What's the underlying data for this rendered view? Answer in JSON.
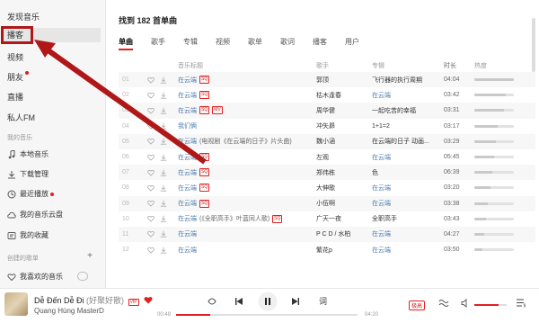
{
  "sidebar": {
    "discover": "发现音乐",
    "podcast": "播客",
    "video": "视频",
    "friends": "朋友",
    "live": "直播",
    "private_fm": "私人FM",
    "my_music_label": "我的音乐",
    "local_music": "本地音乐",
    "downloads": "下载管理",
    "recent": "最近播放",
    "cloud": "我的音乐云盘",
    "collection": "我的收藏",
    "created_label": "创建的歌单",
    "created_plus": "+",
    "liked": "我喜欢的音乐"
  },
  "main": {
    "title": "找到 182 首单曲",
    "tabs": [
      "单曲",
      "歌手",
      "专辑",
      "视频",
      "歌单",
      "歌词",
      "播客",
      "用户"
    ],
    "columns": {
      "title": "音乐标题",
      "artist": "歌手",
      "album": "专辑",
      "duration": "时长",
      "hot": "热度"
    },
    "rows": [
      {
        "num": "01",
        "title": "在云端",
        "tags": [
          "SQ"
        ],
        "rest": "",
        "artist": "郭顶",
        "album": "飞行器的执行周期",
        "album_blue": false,
        "duration": "04:04",
        "hot": 1.0
      },
      {
        "num": "02",
        "title": "在云端",
        "tags": [
          "SQ"
        ],
        "rest": "",
        "artist": "枯木逢春",
        "album": "在云端",
        "album_blue": true,
        "duration": "03:42",
        "hot": 0.8
      },
      {
        "num": "03",
        "title": "在云端",
        "tags": [
          "SQ",
          "MV"
        ],
        "rest": "",
        "artist": "周华健",
        "album": "一起吃苦的幸福",
        "album_blue": false,
        "duration": "03:31",
        "hot": 0.75
      },
      {
        "num": "04",
        "title": "我们俩",
        "tags": [],
        "rest": "",
        "artist": "冲矢昴",
        "album": "1+1=2",
        "album_blue": false,
        "duration": "03:17",
        "hot": 0.6
      },
      {
        "num": "05",
        "title": "在云端",
        "tags": [],
        "rest": "(电视剧《在云端的日子》片头曲)",
        "artist": "魏小涵",
        "album": "在云端的日子 动画...",
        "album_blue": false,
        "duration": "03:29",
        "hot": 0.55
      },
      {
        "num": "06",
        "title": "在云端",
        "tags": [
          "SQ"
        ],
        "rest": "",
        "artist": "左观",
        "album": "在云端",
        "album_blue": true,
        "duration": "05:45",
        "hot": 0.5
      },
      {
        "num": "07",
        "title": "在云端",
        "tags": [
          "SQ"
        ],
        "rest": "",
        "artist": "郑伟栋",
        "album": "色",
        "album_blue": false,
        "duration": "06:39",
        "hot": 0.45
      },
      {
        "num": "08",
        "title": "在云端",
        "tags": [
          "SQ"
        ],
        "rest": "",
        "artist": "大伸歌",
        "album": "在云端",
        "album_blue": true,
        "duration": "03:20",
        "hot": 0.4
      },
      {
        "num": "09",
        "title": "在云端",
        "tags": [
          "SQ"
        ],
        "rest": "",
        "artist": "小伍啊",
        "album": "在云端",
        "album_blue": true,
        "duration": "03:38",
        "hot": 0.35
      },
      {
        "num": "10",
        "title": "在云端",
        "tags": [
          "SQ"
        ],
        "rest": "(《全职高手》叶蓝同人歌)",
        "artist": "广天一夜",
        "album": "全职高手",
        "album_blue": false,
        "duration": "03:43",
        "hot": 0.3
      },
      {
        "num": "11",
        "title": "在云端",
        "tags": [],
        "rest": "",
        "artist": "P C D / 水柏",
        "album": "在云端",
        "album_blue": true,
        "duration": "04:27",
        "hot": 0.25
      },
      {
        "num": "12",
        "title": "在云端",
        "tags": [],
        "rest": "",
        "artist": "繁花p",
        "album": "在云端",
        "album_blue": true,
        "duration": "03:50",
        "hot": 0.2
      }
    ]
  },
  "player": {
    "song": "Dễ Đến Dễ Đi",
    "song_sub": "(好聚好散)",
    "vip": "VIP",
    "artist": "Quang Hùng MasterD",
    "elapsed": "00:49",
    "total": "04:20",
    "progress": 0.19,
    "lyrics_label": "词",
    "quality": "极高",
    "volume": 0.75
  },
  "colors": {
    "accent": "#e02020",
    "annotation": "#b01818",
    "link": "#507daf"
  }
}
